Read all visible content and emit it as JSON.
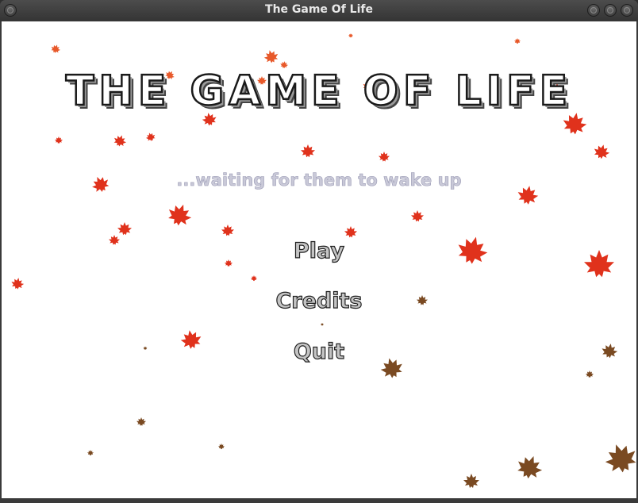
{
  "window": {
    "title": "The Game Of Life"
  },
  "game": {
    "title": "The Game Of Life",
    "subtitle": "...waiting for them to wake up",
    "menu": {
      "play": "Play",
      "credits": "Credits",
      "quit": "Quit"
    }
  },
  "colors": {
    "leaf_red": "#e0321c",
    "leaf_orange": "#e8592a",
    "leaf_brown": "#7a4a22"
  }
}
